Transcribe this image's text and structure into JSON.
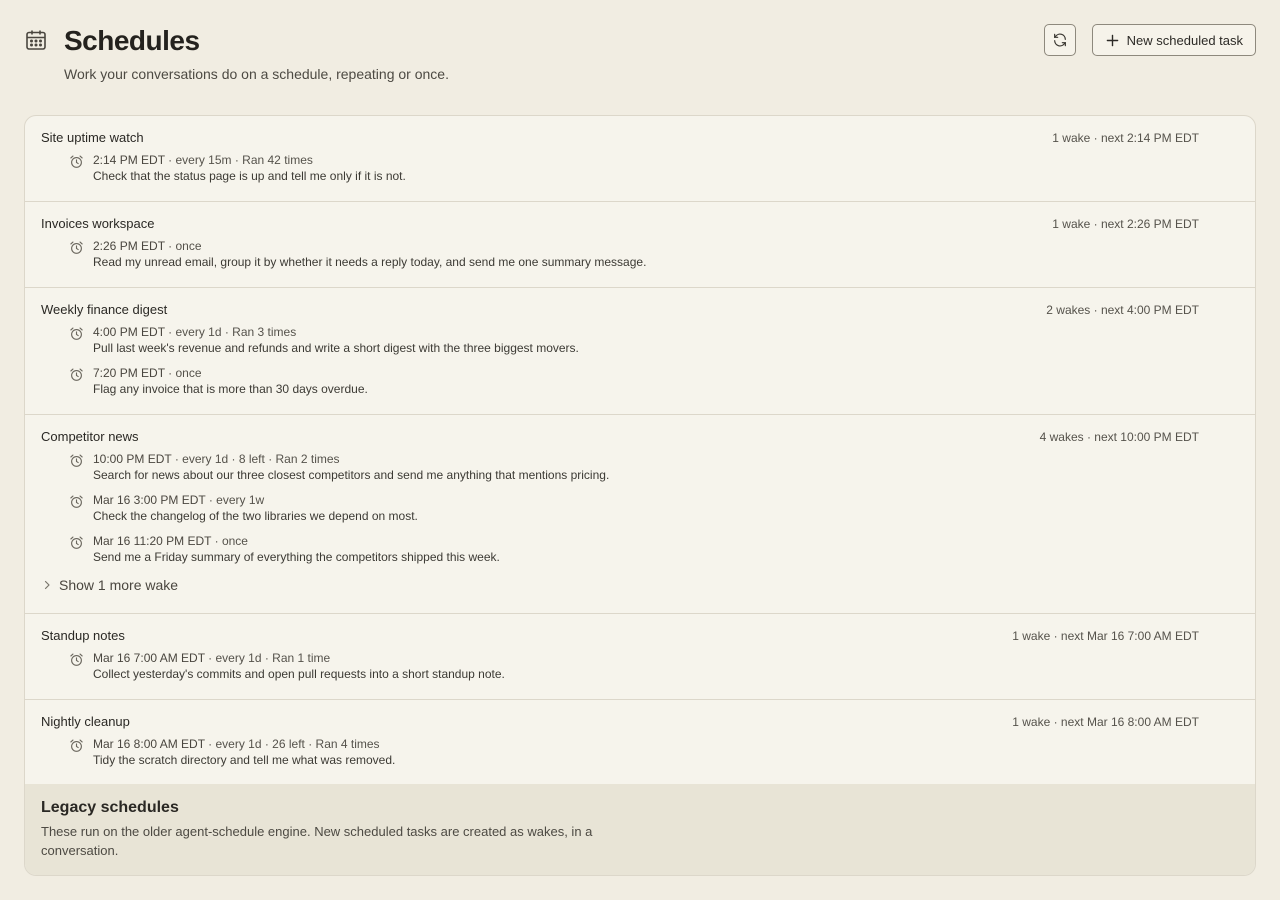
{
  "header": {
    "icon": "calendar-icon",
    "title": "Schedules",
    "subtitle": "Work your conversations do on a schedule, repeating or once.",
    "refresh_icon": "refresh-icon",
    "new_button_label": "New scheduled task"
  },
  "groups": [
    {
      "title": "Site uptime watch",
      "meta": "1 wake · next 2:14 PM EDT",
      "wakes": [
        {
          "time": "2:14 PM EDT",
          "detail": " · every 15m · Ran 42 times",
          "desc": "Check that the status page is up and tell me only if it is not."
        }
      ]
    },
    {
      "title": "Invoices workspace",
      "meta": "1 wake · next 2:26 PM EDT",
      "wakes": [
        {
          "time": "2:26 PM EDT",
          "detail": " · once",
          "desc": "Read my unread email, group it by whether it needs a reply today, and send me one summary message."
        }
      ]
    },
    {
      "title": "Weekly finance digest",
      "meta": "2 wakes · next 4:00 PM EDT",
      "wakes": [
        {
          "time": "4:00 PM EDT",
          "detail": " · every 1d · Ran 3 times",
          "desc": "Pull last week's revenue and refunds and write a short digest with the three biggest movers."
        },
        {
          "time": "7:20 PM EDT",
          "detail": " · once",
          "desc": "Flag any invoice that is more than 30 days overdue."
        }
      ]
    },
    {
      "title": "Competitor news",
      "meta": "4 wakes · next 10:00 PM EDT",
      "wakes": [
        {
          "time": "10:00 PM EDT",
          "detail": " · every 1d · 8 left · Ran 2 times",
          "desc": "Search for news about our three closest competitors and send me anything that mentions pricing."
        },
        {
          "time": "Mar 16 3:00 PM EDT",
          "detail": " · every 1w",
          "desc": "Check the changelog of the two libraries we depend on most."
        },
        {
          "time": "Mar 16 11:20 PM EDT",
          "detail": " · once",
          "desc": "Send me a Friday summary of everything the competitors shipped this week."
        }
      ],
      "show_more": "Show 1 more wake"
    },
    {
      "title": "Standup notes",
      "meta": "1 wake · next Mar 16 7:00 AM EDT",
      "wakes": [
        {
          "time": "Mar 16 7:00 AM EDT",
          "detail": " · every 1d · Ran 1 time",
          "desc": "Collect yesterday's commits and open pull requests into a short standup note."
        }
      ]
    },
    {
      "title": "Nightly cleanup",
      "meta": "1 wake · next Mar 16 8:00 AM EDT",
      "wakes": [
        {
          "time": "Mar 16 8:00 AM EDT",
          "detail": " · every 1d · 26 left · Ran 4 times",
          "desc": "Tidy the scratch directory and tell me what was removed."
        }
      ]
    }
  ],
  "legacy": {
    "title": "Legacy schedules",
    "description": "These run on the older agent-schedule engine. New scheduled tasks are created as wakes, in a conversation."
  }
}
